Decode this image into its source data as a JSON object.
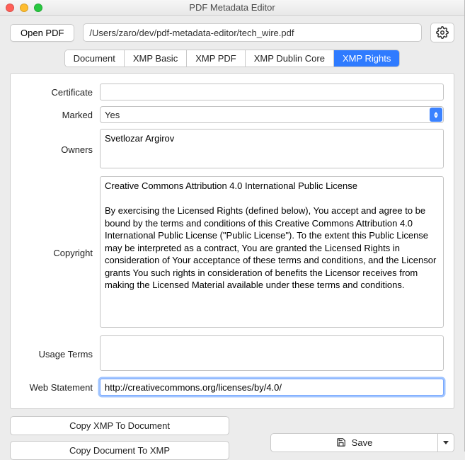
{
  "window": {
    "title": "PDF Metadata Editor"
  },
  "toolbar": {
    "open_label": "Open PDF",
    "path": "/Users/zaro/dev/pdf-metadata-editor/tech_wire.pdf"
  },
  "tabs": [
    {
      "label": "Document",
      "active": false
    },
    {
      "label": "XMP Basic",
      "active": false
    },
    {
      "label": "XMP PDF",
      "active": false
    },
    {
      "label": "XMP Dublin Core",
      "active": false
    },
    {
      "label": "XMP Rights",
      "active": true
    }
  ],
  "form": {
    "labels": {
      "certificate": "Certificate",
      "marked": "Marked",
      "owners": "Owners",
      "copyright": "Copyright",
      "usage": "Usage Terms",
      "webstatement": "Web Statement"
    },
    "certificate": "",
    "marked": "Yes",
    "owners": "Svetlozar Argirov",
    "copyright": "Creative Commons Attribution 4.0 International Public License\n\nBy exercising the Licensed Rights (defined below), You accept and agree to be bound by the terms and conditions of this Creative Commons Attribution 4.0 International Public License (\"Public License\"). To the extent this Public License may be interpreted as a contract, You are granted the Licensed Rights in consideration of Your acceptance of these terms and conditions, and the Licensor grants You such rights in consideration of benefits the Licensor receives from making the Licensed Material available under these terms and conditions.",
    "usage": "",
    "webstatement": "http://creativecommons.org/licenses/by/4.0/"
  },
  "actions": {
    "copy_xmp_to_doc": "Copy XMP To Document",
    "copy_doc_to_xmp": "Copy Document To XMP",
    "save": "Save"
  }
}
